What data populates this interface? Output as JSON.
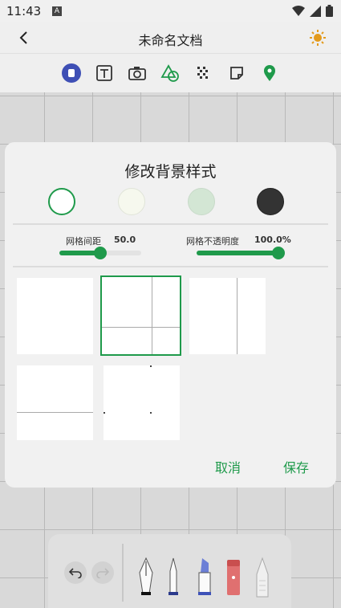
{
  "status": {
    "time": "11:43",
    "notif": "A"
  },
  "app": {
    "title": "未命名文档"
  },
  "toolbar": {
    "icons": [
      "hand-icon",
      "text-icon",
      "camera-icon",
      "shapes-icon",
      "dots-icon",
      "sticky-note-icon",
      "location-pin-icon"
    ]
  },
  "colors": {
    "accent": "#1f9a4b",
    "swatches": [
      "#ffffff",
      "#f6f8ee",
      "#d3e6d4",
      "#333333"
    ]
  },
  "dialog": {
    "title": "修改背景样式",
    "grid_spacing_label": "网格间距",
    "grid_spacing_value": "50.0",
    "grid_spacing_progress": 0.5,
    "grid_opacity_label": "网格不透明度",
    "grid_opacity_value": "100.0%",
    "grid_opacity_progress": 1.0,
    "cancel_label": "取消",
    "save_label": "保存",
    "selected_pattern": "grid"
  }
}
